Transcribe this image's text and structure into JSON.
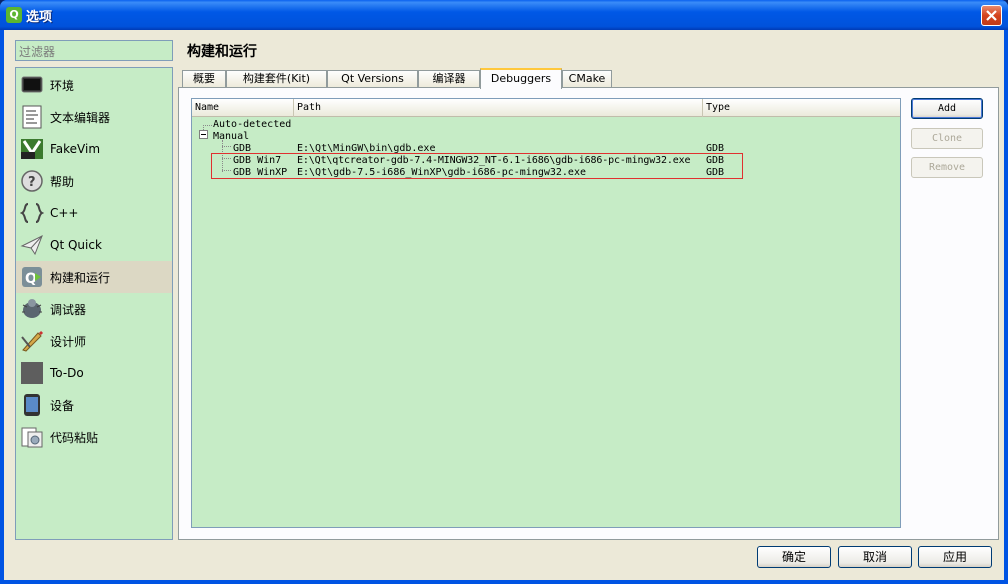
{
  "window": {
    "title": "选项",
    "app_icon": "qt-icon"
  },
  "sidebar": {
    "filter_placeholder": "过滤器",
    "items": [
      {
        "label": "环境",
        "icon": "monitor-icon"
      },
      {
        "label": "文本编辑器",
        "icon": "text-editor-icon"
      },
      {
        "label": "FakeVim",
        "icon": "fakevim-icon"
      },
      {
        "label": "帮助",
        "icon": "help-icon"
      },
      {
        "label": "C++",
        "icon": "braces-icon"
      },
      {
        "label": "Qt Quick",
        "icon": "paper-plane-icon"
      },
      {
        "label": "构建和运行",
        "icon": "qt-build-icon",
        "selected": true
      },
      {
        "label": "调试器",
        "icon": "debugger-icon"
      },
      {
        "label": "设计师",
        "icon": "designer-icon"
      },
      {
        "label": "To-Do",
        "icon": "todo-icon"
      },
      {
        "label": "设备",
        "icon": "device-icon"
      },
      {
        "label": "代码粘贴",
        "icon": "code-paste-icon"
      }
    ]
  },
  "main": {
    "page_title": "构建和运行",
    "tabs": [
      {
        "label": "概要"
      },
      {
        "label": "构建套件(Kit)"
      },
      {
        "label": "Qt Versions"
      },
      {
        "label": "编译器"
      },
      {
        "label": "Debuggers",
        "active": true
      },
      {
        "label": "CMake"
      }
    ],
    "tree": {
      "columns": [
        "Name",
        "Path",
        "Type"
      ],
      "groups": {
        "auto_detected": "Auto-detected",
        "manual": "Manual"
      },
      "rows": [
        {
          "name": "GDB",
          "path": "E:\\Qt\\MinGW\\bin\\gdb.exe",
          "type": "GDB"
        },
        {
          "name": "GDB Win7",
          "path": "E:\\Qt\\qtcreator-gdb-7.4-MINGW32_NT-6.1-i686\\gdb-i686-pc-mingw32.exe",
          "type": "GDB"
        },
        {
          "name": "GDB WinXP",
          "path": "E:\\Qt\\gdb-7.5-i686_WinXP\\gdb-i686-pc-mingw32.exe",
          "type": "GDB"
        }
      ]
    },
    "buttons": {
      "add": "Add",
      "clone": "Clone",
      "remove": "Remove"
    }
  },
  "footer": {
    "ok": "确定",
    "cancel": "取消",
    "apply": "应用"
  },
  "colors": {
    "panel_green": "#c6ecc6",
    "title_blue": "#0054e3",
    "highlight_red": "#e03030"
  }
}
